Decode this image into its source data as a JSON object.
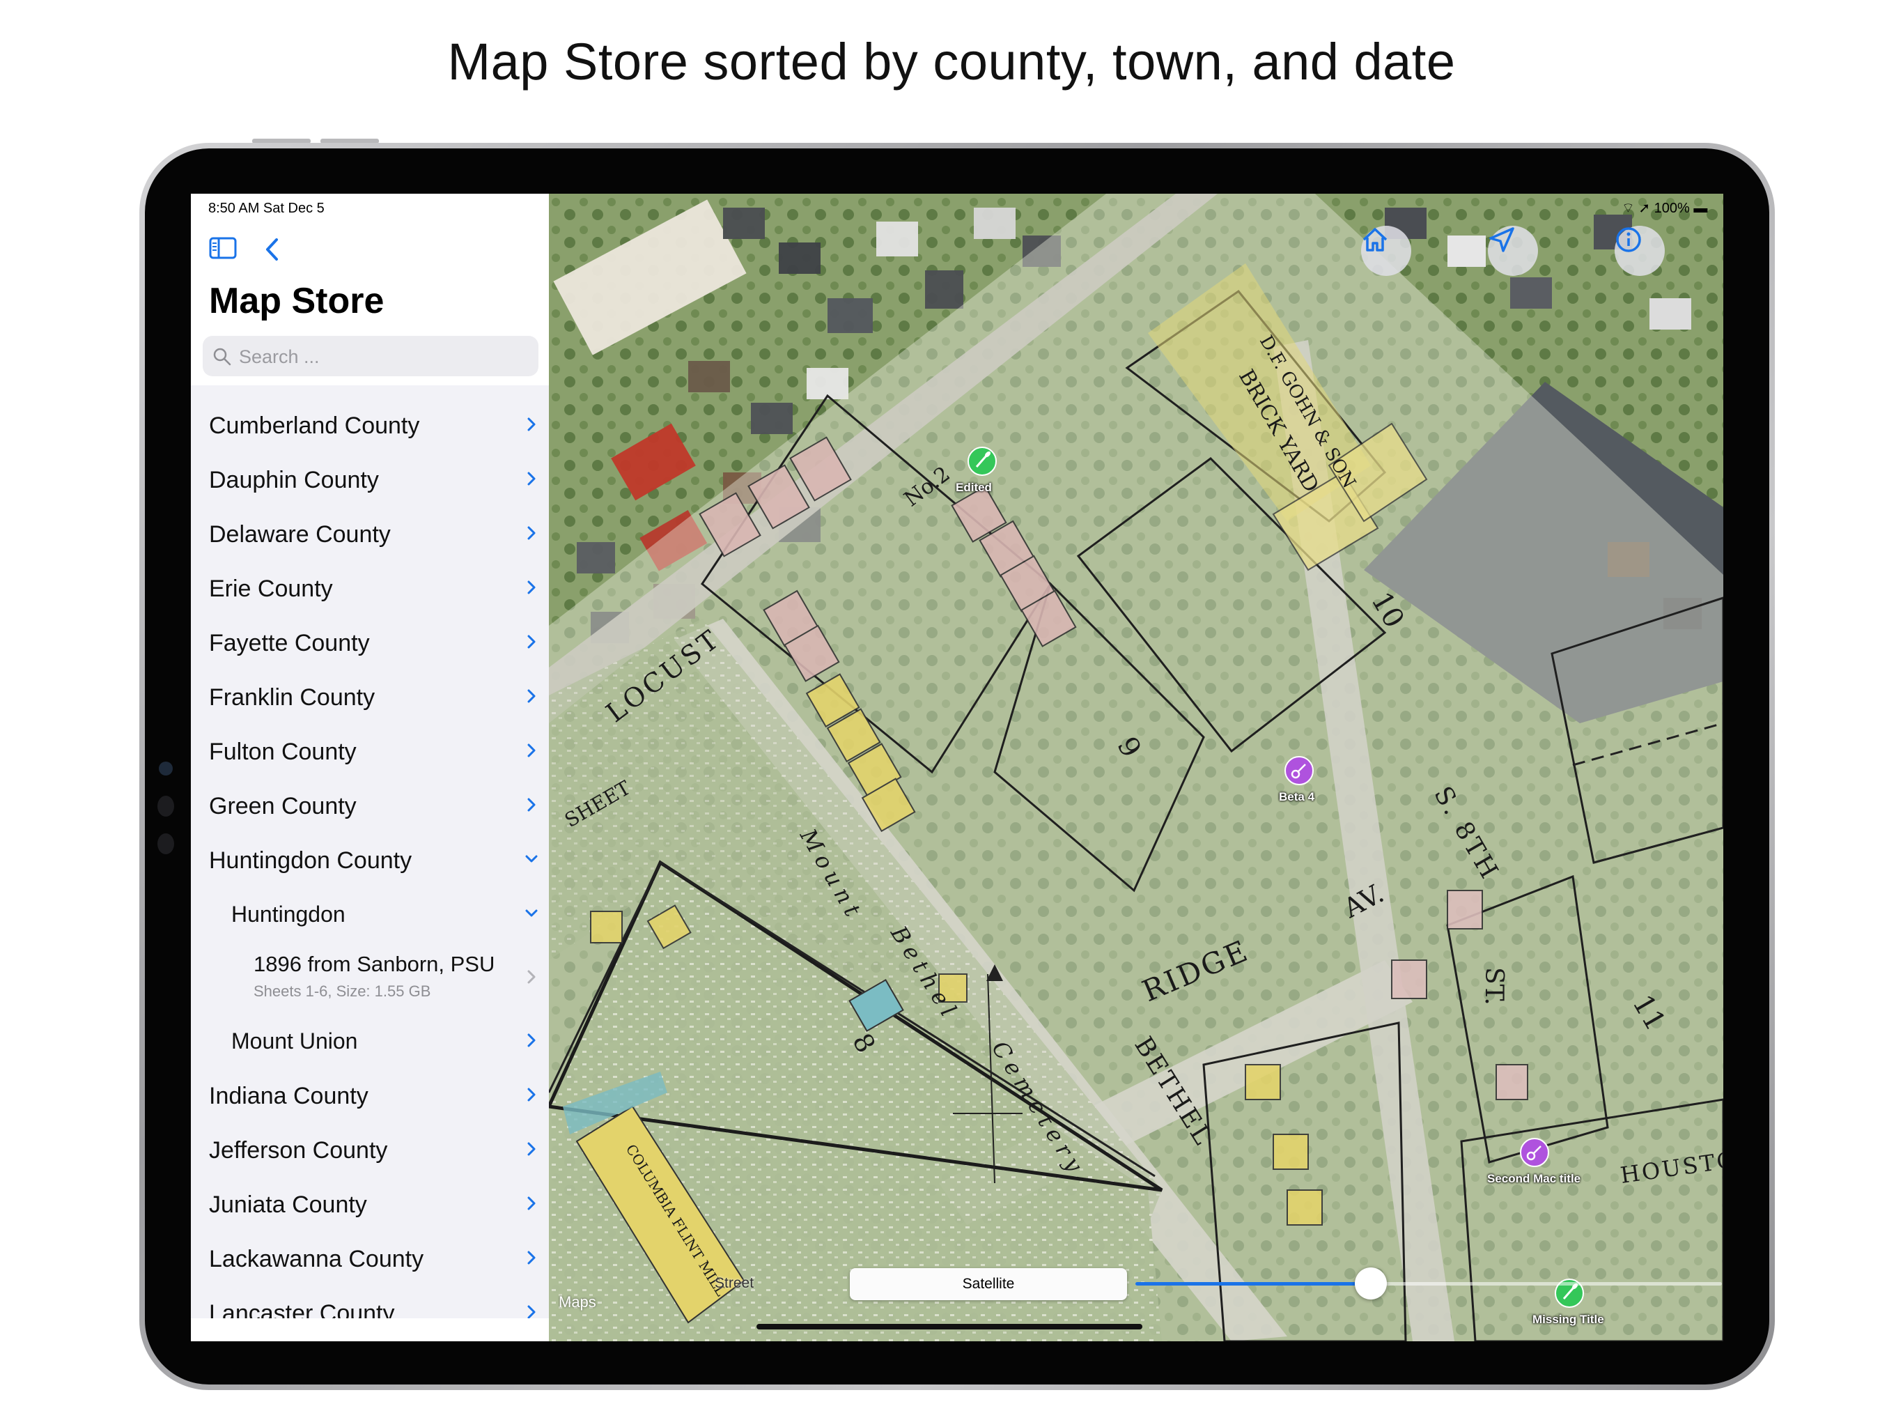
{
  "caption": "Map Store sorted by county, town, and date",
  "status_bar": {
    "time": "8:50 AM  Sat Dec 5",
    "battery": "100%"
  },
  "sidebar": {
    "title": "Map Store",
    "search_placeholder": "Search ...",
    "items": [
      {
        "label": "Cumberland County",
        "level": 0,
        "expanded": false
      },
      {
        "label": "Dauphin County",
        "level": 0,
        "expanded": false
      },
      {
        "label": "Delaware County",
        "level": 0,
        "expanded": false
      },
      {
        "label": "Erie County",
        "level": 0,
        "expanded": false
      },
      {
        "label": "Fayette County",
        "level": 0,
        "expanded": false
      },
      {
        "label": "Franklin County",
        "level": 0,
        "expanded": false
      },
      {
        "label": "Fulton County",
        "level": 0,
        "expanded": false
      },
      {
        "label": "Green County",
        "level": 0,
        "expanded": false
      },
      {
        "label": "Huntingdon County",
        "level": 0,
        "expanded": true
      },
      {
        "label": "Huntingdon",
        "level": 1,
        "expanded": true
      },
      {
        "label": "1896 from Sanborn, PSU",
        "subtitle": "Sheets 1-6, Size: 1.55 GB",
        "level": 2
      },
      {
        "label": "Mount Union",
        "level": 1,
        "expanded": false
      },
      {
        "label": "Indiana County",
        "level": 0,
        "expanded": false
      },
      {
        "label": "Jefferson County",
        "level": 0,
        "expanded": false
      },
      {
        "label": "Juniata County",
        "level": 0,
        "expanded": false
      },
      {
        "label": "Lackawanna County",
        "level": 0,
        "expanded": false
      },
      {
        "label": "Lancaster County",
        "level": 0,
        "expanded": false
      }
    ]
  },
  "map": {
    "pins": [
      {
        "label": "Edited",
        "color": "#34c759",
        "icon": "shovel-icon"
      },
      {
        "label": "Beta 4",
        "color": "#af52de",
        "icon": "guitar-icon"
      },
      {
        "label": "Second Mac title",
        "color": "#af52de",
        "icon": "guitar-icon"
      },
      {
        "label": "Missing Title",
        "color": "#34c759",
        "icon": "shovel-icon"
      }
    ],
    "map_text": {
      "locust": "LOCUST",
      "sheet": "SHEET",
      "no2": "No.2",
      "ridge": "RIDGE",
      "av": "AV.",
      "bethel": "BETHEL",
      "s8th": "S. 8TH",
      "st": "ST.",
      "houston": "HOUSTO",
      "gohn": "D.F. GOHN & SON",
      "brick_yard": "BRICK YARD",
      "mount": "Mount",
      "bethel_cem": "Bethel",
      "cemetery": "Cemetery",
      "columbia": "COLUMBIA FLINT MILL",
      "num_8": "8",
      "num_9": "9",
      "num_10": "10",
      "num_11": "11"
    },
    "map_type_label": "Satellite",
    "street_label": "Street",
    "maps_credit": "Maps",
    "opacity_slider_value": 0.75
  }
}
